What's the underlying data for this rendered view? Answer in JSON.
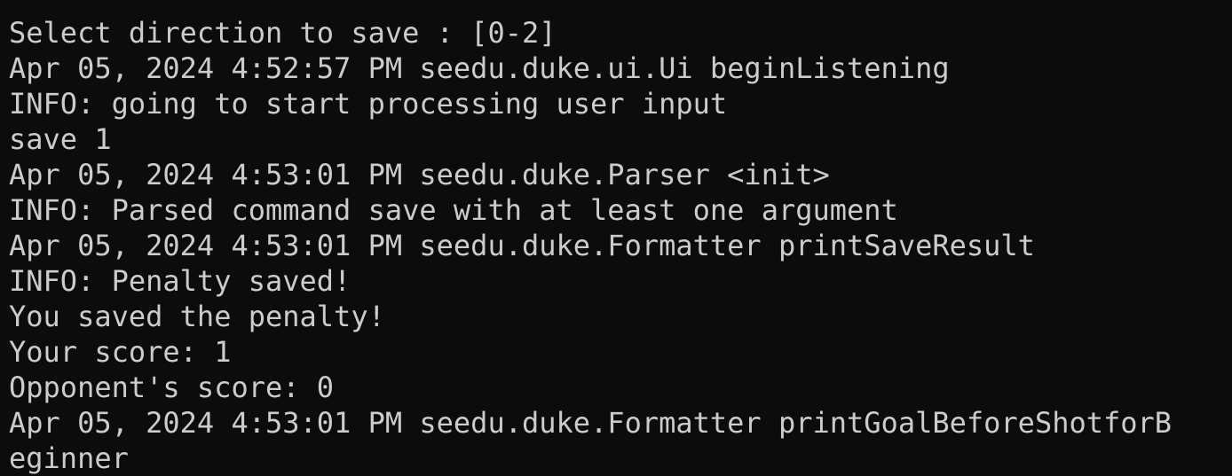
{
  "terminal": {
    "lines": [
      "Select direction to save : [0-2]",
      "Apr 05, 2024 4:52:57 PM seedu.duke.ui.Ui beginListening",
      "INFO: going to start processing user input",
      "save 1",
      "Apr 05, 2024 4:53:01 PM seedu.duke.Parser <init>",
      "INFO: Parsed command save with at least one argument",
      "Apr 05, 2024 4:53:01 PM seedu.duke.Formatter printSaveResult",
      "INFO: Penalty saved!",
      "You saved the penalty!",
      "Your score: 1",
      "Opponent's score: 0",
      "Apr 05, 2024 4:53:01 PM seedu.duke.Formatter printGoalBeforeShotforB",
      "eginner"
    ]
  },
  "colors": {
    "background": "#0c0c0c",
    "text": "#cccccc"
  }
}
